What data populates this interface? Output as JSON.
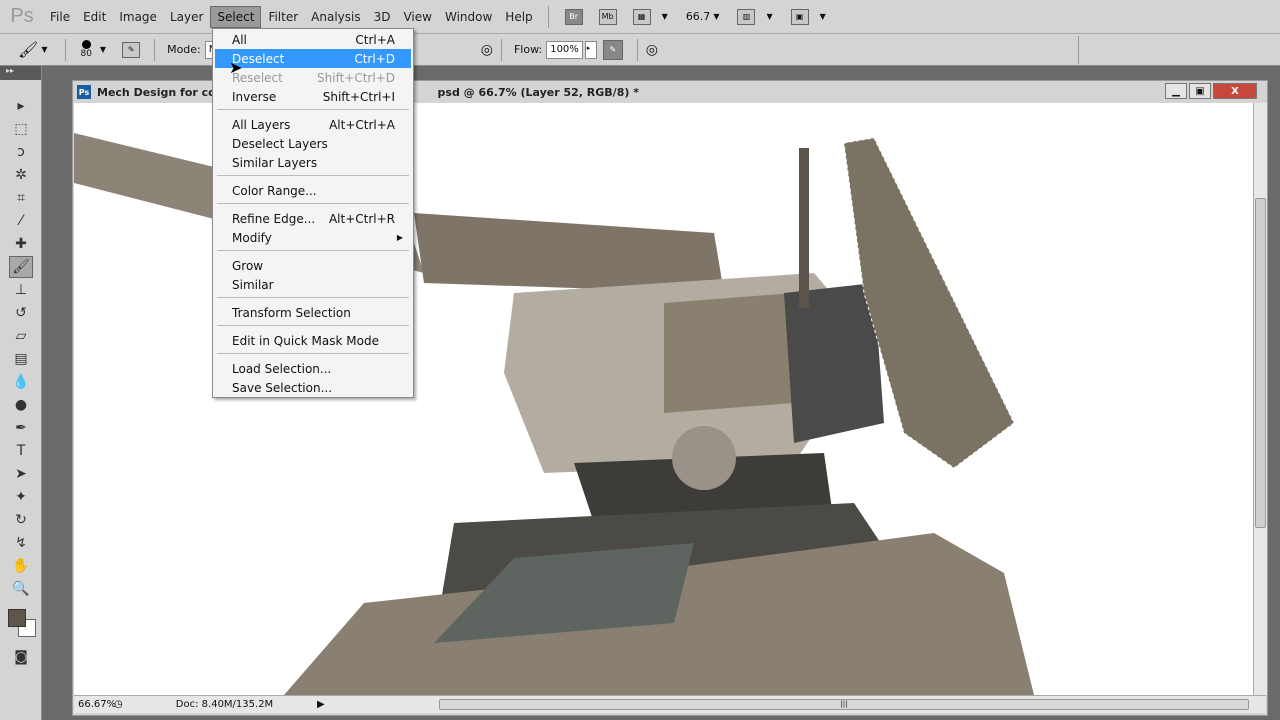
{
  "menubar": {
    "logo": "Ps",
    "items": [
      "File",
      "Edit",
      "Image",
      "Layer",
      "Select",
      "Filter",
      "Analysis",
      "3D",
      "View",
      "Window",
      "Help"
    ],
    "active": "Select",
    "bridge": "Br",
    "minibridge": "Mb",
    "zoom": "66.7"
  },
  "options": {
    "brush_size": "80",
    "mode_label": "Mode:",
    "mode_value": "Normal",
    "flow_label": "Flow:",
    "flow_value": "100%"
  },
  "document": {
    "title": "Mech Design for concept.psd @ 66.7% (Layer 52, RGB/8) *",
    "title_left": "Mech Design for conce",
    "title_right": "psd @ 66.7% (Layer 52, RGB/8) *",
    "zoom": "66.67%",
    "doc_size": "Doc: 8.40M/135.2M"
  },
  "select_menu": {
    "items": [
      {
        "label": "All",
        "shortcut": "Ctrl+A"
      },
      {
        "label": "Deselect",
        "shortcut": "Ctrl+D",
        "highlighted": true
      },
      {
        "label": "Reselect",
        "shortcut": "Shift+Ctrl+D",
        "disabled": true
      },
      {
        "label": "Inverse",
        "shortcut": "Shift+Ctrl+I"
      },
      {
        "label": "All Layers",
        "shortcut": "Alt+Ctrl+A"
      },
      {
        "label": "Deselect Layers",
        "shortcut": ""
      },
      {
        "label": "Similar Layers",
        "shortcut": ""
      },
      {
        "label": "Color Range...",
        "shortcut": ""
      },
      {
        "label": "Refine Edge...",
        "shortcut": "Alt+Ctrl+R"
      },
      {
        "label": "Modify",
        "shortcut": ""
      },
      {
        "label": "Grow",
        "shortcut": ""
      },
      {
        "label": "Similar",
        "shortcut": ""
      },
      {
        "label": "Transform Selection",
        "shortcut": ""
      },
      {
        "label": "Edit in Quick Mask Mode",
        "shortcut": ""
      },
      {
        "label": "Load Selection...",
        "shortcut": ""
      },
      {
        "label": "Save Selection...",
        "shortcut": ""
      }
    ]
  },
  "colors": {
    "highlight": "#3399ff",
    "foreground": "#5e5648",
    "background": "#ffffff",
    "mech": "#8a8072"
  }
}
